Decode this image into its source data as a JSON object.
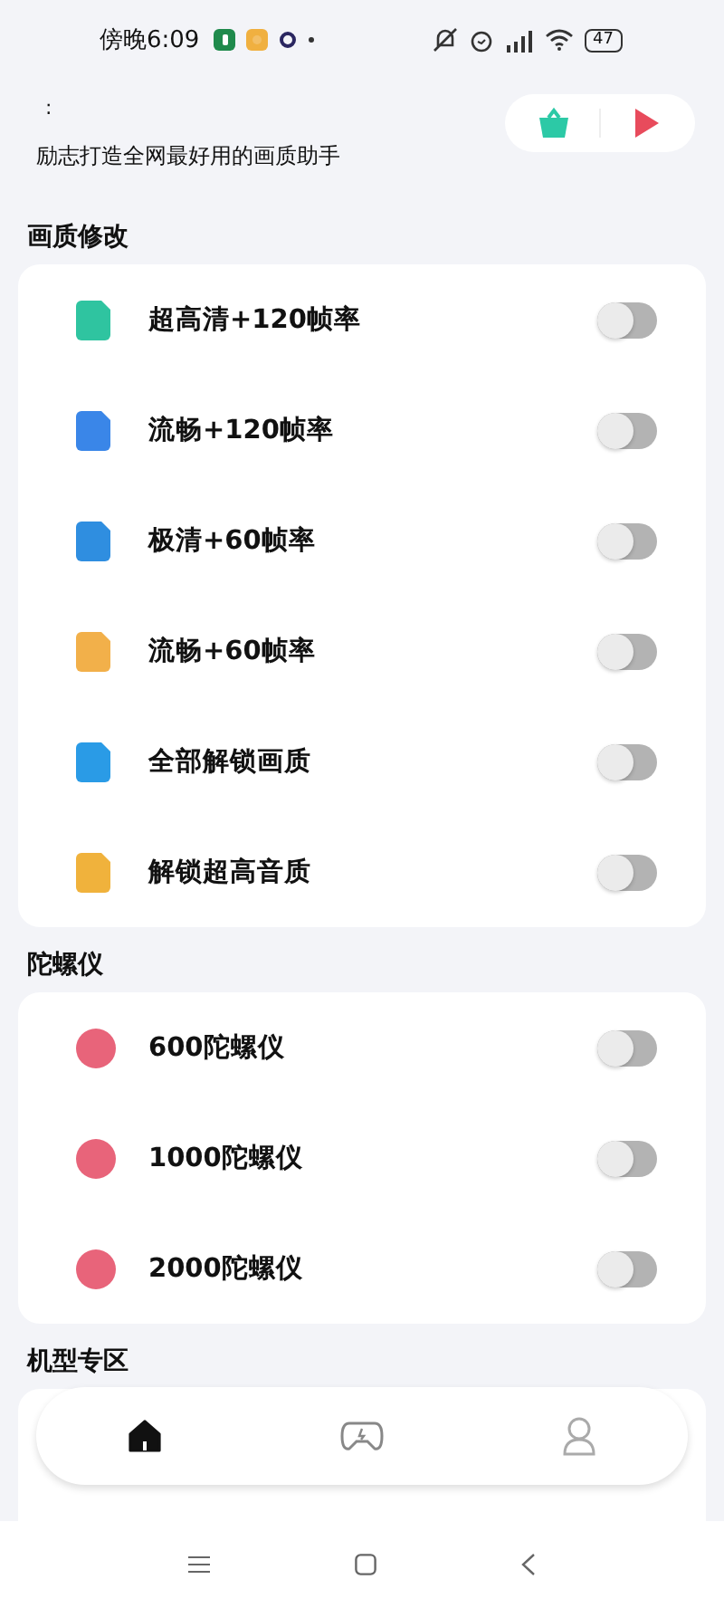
{
  "status_bar": {
    "time": "傍晚6:09",
    "battery": "47"
  },
  "header": {
    "mark": ":",
    "subtitle": "励志打造全网最好用的画质助手"
  },
  "sections": [
    {
      "title": "画质修改",
      "kind": "square",
      "items": [
        {
          "label": "超高清+120帧率",
          "color": "#2fc4a0",
          "on": false
        },
        {
          "label": "流畅+120帧率",
          "color": "#3a86e8",
          "on": false
        },
        {
          "label": "极清+60帧率",
          "color": "#2f8ee0",
          "on": false
        },
        {
          "label": "流畅+60帧率",
          "color": "#f2b04a",
          "on": false
        },
        {
          "label": "全部解锁画质",
          "color": "#2a9be6",
          "on": false
        },
        {
          "label": "解锁超高音质",
          "color": "#f0b23c",
          "on": false
        }
      ]
    },
    {
      "title": "陀螺仪",
      "kind": "circle",
      "items": [
        {
          "label": "600陀螺仪",
          "color": "#e8647a",
          "on": false
        },
        {
          "label": "1000陀螺仪",
          "color": "#e8647a",
          "on": false
        },
        {
          "label": "2000陀螺仪",
          "color": "#e8647a",
          "on": false
        }
      ]
    },
    {
      "title": "机型专区"
    }
  ],
  "tabs": [
    {
      "selected": true
    },
    {
      "selected": false
    },
    {
      "selected": false
    }
  ]
}
